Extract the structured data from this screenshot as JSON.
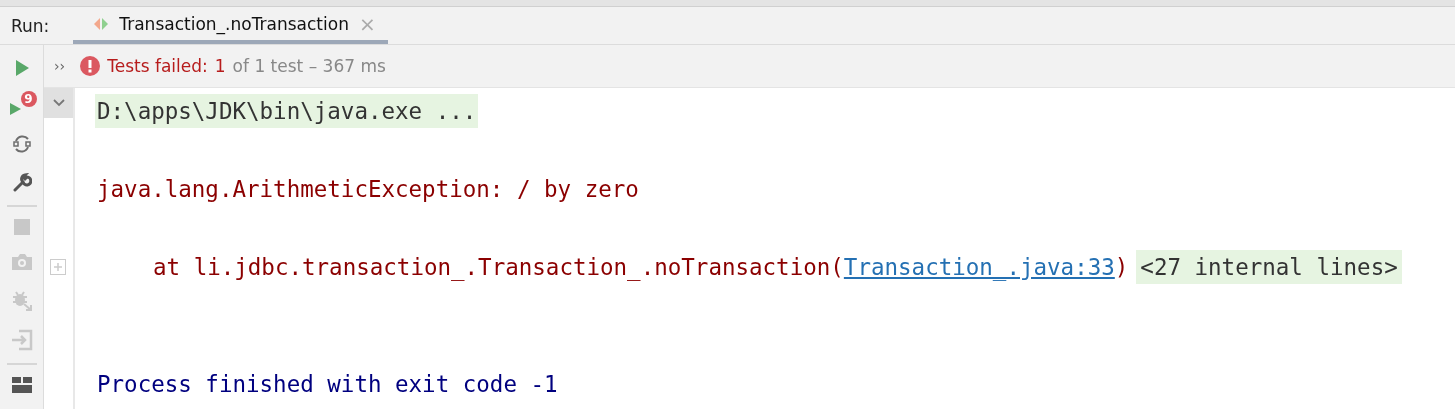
{
  "tool_window": {
    "label": "Run:",
    "tabs": [
      {
        "label": "Transaction_.noTransaction",
        "close": "×",
        "selected": true
      }
    ]
  },
  "status": {
    "expand": "››",
    "failed_label": "Tests failed:",
    "failed_count": "1",
    "summary": "of 1 test – 367 ms"
  },
  "toolbar": {
    "rerun_badge": "9"
  },
  "console": {
    "expanded": true,
    "lines": [
      {
        "kind": "command",
        "text": "D:\\apps\\JDK\\bin\\java.exe ..."
      },
      {
        "kind": "blank"
      },
      {
        "kind": "error",
        "text": "java.lang.ArithmeticException: / by zero"
      },
      {
        "kind": "blank"
      },
      {
        "kind": "stack",
        "text": "at li.jdbc.transaction_.Transaction_.noTransaction(",
        "link": "Transaction_.java:33",
        "suffix": ")",
        "folded": "<27 internal lines>"
      },
      {
        "kind": "blank"
      },
      {
        "kind": "blank"
      },
      {
        "kind": "exit",
        "text": "Process finished with exit code -1"
      }
    ]
  }
}
